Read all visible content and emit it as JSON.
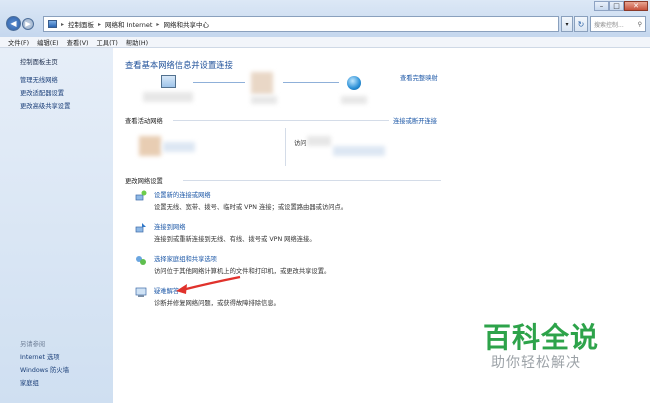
{
  "address": {
    "crumbs": [
      "控制面板",
      "网络和 Internet",
      "网络和共享中心"
    ],
    "search_placeholder": "搜索控制..."
  },
  "menu": [
    "文件(F)",
    "编辑(E)",
    "查看(V)",
    "工具(T)",
    "帮助(H)"
  ],
  "sidebar": {
    "items": [
      "控制面板主页",
      "管理无线网络",
      "更改适配器设置",
      "更改高级共享设置"
    ],
    "see_also": "另请参阅",
    "see_also_items": [
      "Internet 选项",
      "Windows 防火墙",
      "家庭组"
    ]
  },
  "main": {
    "title": "查看基本网络信息并设置连接",
    "full_map": "查看完整映射",
    "active_networks": "查看活动网络",
    "connect_disconnect": "连接或断开连接",
    "partial_label": "访问",
    "change_settings": "更改网络设置",
    "tasks": [
      {
        "title": "设置新的连接或网络",
        "desc": "设置无线、宽带、拨号、临时或 VPN 连接；或设置路由器或访问点。"
      },
      {
        "title": "连接到网络",
        "desc": "连接到或重新连接到无线、有线、拨号或 VPN 网络连接。"
      },
      {
        "title": "选择家庭组和共享选项",
        "desc": "访问位于其他网络计算机上的文件和打印机，或更改共享设置。"
      },
      {
        "title": "疑难解答",
        "desc": "诊断并修复网络问题，或获得故障排除信息。"
      }
    ]
  },
  "watermark": {
    "big": "百科全说",
    "small": "助你轻松解决"
  },
  "colors": {
    "accent": "#1a56a6",
    "watermark_green": "#2da34a",
    "arrow_red": "#e0322c"
  }
}
